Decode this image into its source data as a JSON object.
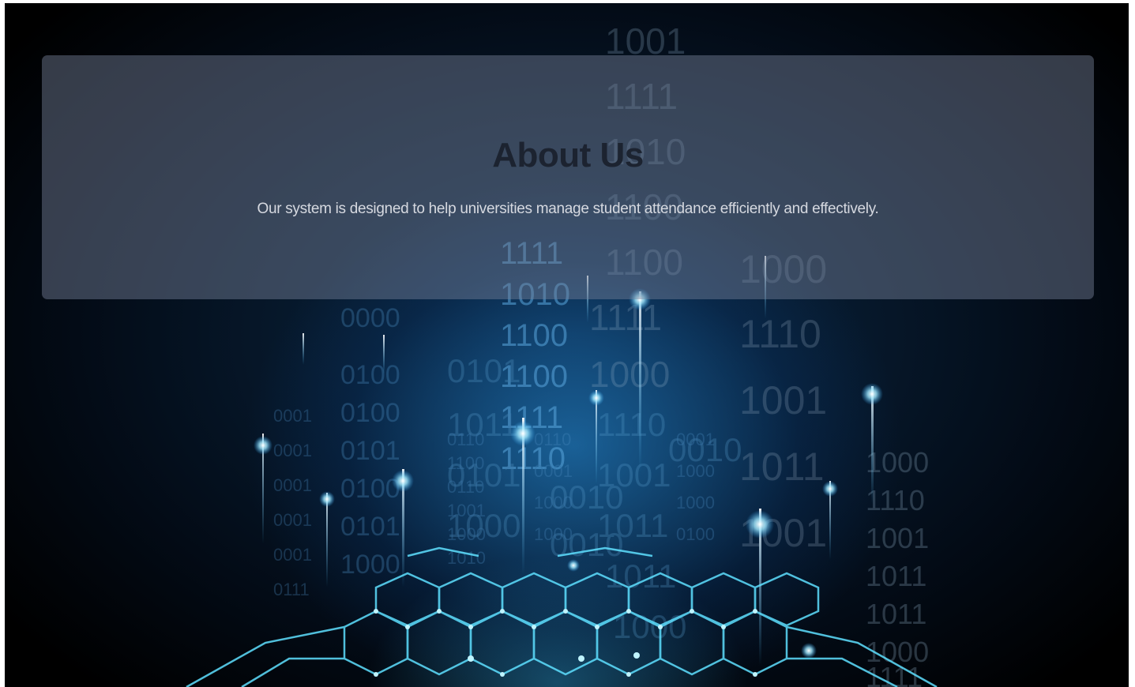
{
  "about": {
    "title": "About Us",
    "description": "Our system is designed to help universities manage student attendance efficiently and effectively."
  },
  "background": {
    "icon": "binary-code-network-illustration",
    "colors": {
      "dark": "#000000",
      "glow": "#2a9be6",
      "accent": "#6fe3ff"
    }
  }
}
